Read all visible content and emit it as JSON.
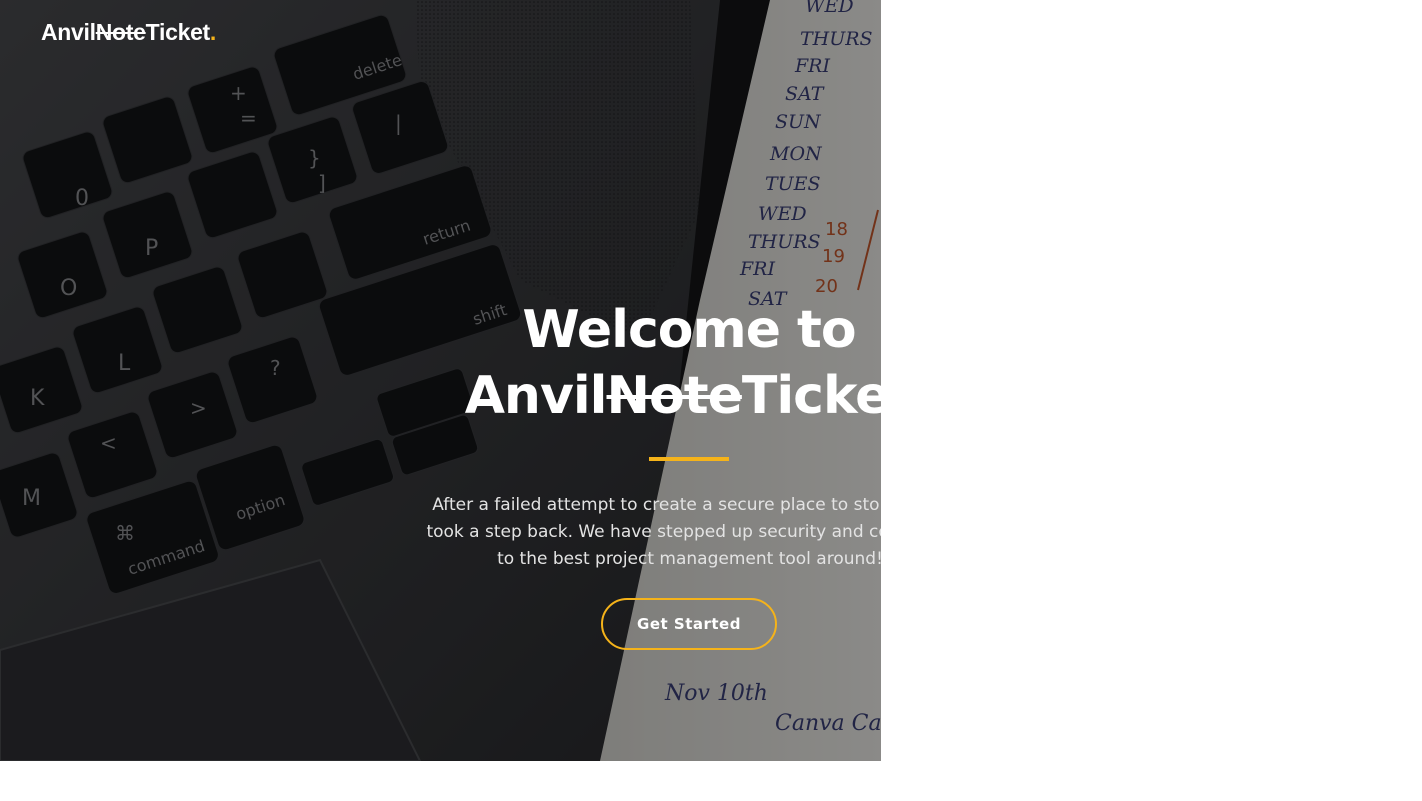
{
  "brand": {
    "prefix": "Anvil",
    "struck": "Note",
    "suffix": "Ticket",
    "dot": ".",
    "accent": "#f5b31a"
  },
  "hero": {
    "headline_line1": "Welcome to",
    "headline_prefix": "Anvil",
    "headline_struck": "Note",
    "headline_suffix": "Ticket",
    "description_line1": "After a failed attempt to create a secure place to store all yo",
    "description_line2": "took a step back. We have stepped up security and convertec",
    "description_line3": "to the best project management tool around!",
    "cta_label": "Get Started"
  },
  "background": {
    "keys": [
      "delete",
      "+",
      "=",
      "_",
      "-",
      ")",
      "0",
      "}",
      "]",
      "{",
      "[",
      "|",
      "\\",
      "P",
      "O",
      "return",
      "\"",
      "'",
      ":",
      ";",
      "shift",
      "L",
      "K",
      "?",
      "/",
      ">",
      ".",
      "<",
      ",",
      "M",
      "option",
      "command",
      "⌘",
      "⌥"
    ],
    "notebook": [
      "WED",
      "THURS",
      "FRI",
      "SAT",
      "SUN",
      "MON",
      "TUES",
      "WED",
      "THURS",
      "FRI",
      "SAT",
      "Nov 10th",
      "Canva Ca"
    ]
  }
}
